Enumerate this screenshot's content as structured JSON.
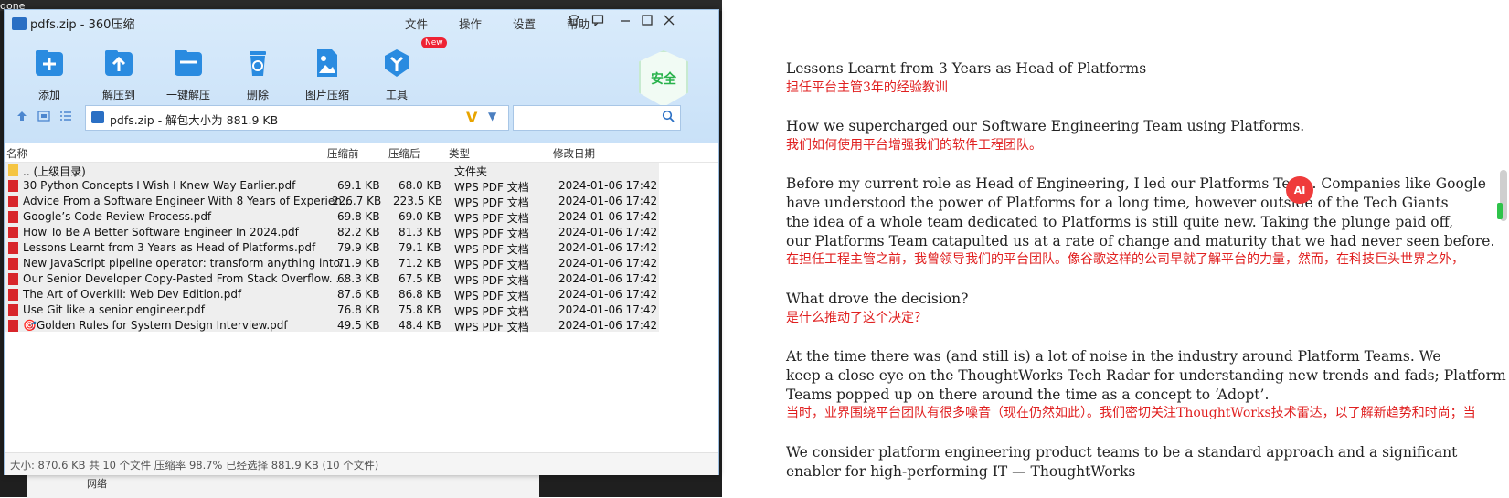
{
  "background": {
    "top_left_text": "done",
    "explorer_item": "网络"
  },
  "window": {
    "title": "pdfs.zip - 360压缩",
    "menus": [
      "文件",
      "操作",
      "设置",
      "帮助"
    ],
    "toolbar": [
      {
        "label": "添加",
        "icon": "add-icon"
      },
      {
        "label": "解压到",
        "icon": "extract-to-icon"
      },
      {
        "label": "一键解压",
        "icon": "one-click-extract-icon"
      },
      {
        "label": "删除",
        "icon": "delete-icon"
      },
      {
        "label": "图片压缩",
        "icon": "image-compress-icon"
      },
      {
        "label": "工具",
        "icon": "tools-icon"
      }
    ],
    "new_tag": "New",
    "safety_badge": "安全",
    "address": "pdfs.zip - 解包大小为 881.9 KB",
    "columns": [
      "名称",
      "压缩前",
      "压缩后",
      "类型",
      "修改日期"
    ],
    "parent_row": {
      "name": ".. (上级目录)",
      "type": "文件夹"
    },
    "files": [
      {
        "name": "30 Python Concepts I Wish I Knew Way Earlier.pdf",
        "before": "69.1 KB",
        "after": "68.0 KB",
        "type": "WPS PDF 文档",
        "date": "2024-01-06 17:42"
      },
      {
        "name": "Advice From a Software Engineer With 8 Years of Experien...",
        "before": "226.7 KB",
        "after": "223.5 KB",
        "type": "WPS PDF 文档",
        "date": "2024-01-06 17:42"
      },
      {
        "name": "Google’s Code Review Process.pdf",
        "before": "69.8 KB",
        "after": "69.0 KB",
        "type": "WPS PDF 文档",
        "date": "2024-01-06 17:42"
      },
      {
        "name": "How To Be A Better Software Engineer In 2024.pdf",
        "before": "82.2 KB",
        "after": "81.3 KB",
        "type": "WPS PDF 文档",
        "date": "2024-01-06 17:42"
      },
      {
        "name": "Lessons Learnt from 3 Years as Head of Platforms.pdf",
        "before": "79.9 KB",
        "after": "79.1 KB",
        "type": "WPS PDF 文档",
        "date": "2024-01-06 17:42"
      },
      {
        "name": "New JavaScript pipeline operator: transform anything into...",
        "before": "71.9 KB",
        "after": "71.2 KB",
        "type": "WPS PDF 文档",
        "date": "2024-01-06 17:42"
      },
      {
        "name": "Our Senior Developer Copy-Pasted From Stack Overflow. ...",
        "before": "68.3 KB",
        "after": "67.5 KB",
        "type": "WPS PDF 文档",
        "date": "2024-01-06 17:42"
      },
      {
        "name": "The Art of Overkill: Web Dev Edition.pdf",
        "before": "87.6 KB",
        "after": "86.8 KB",
        "type": "WPS PDF 文档",
        "date": "2024-01-06 17:42"
      },
      {
        "name": "Use Git like a senior engineer.pdf",
        "before": "76.8 KB",
        "after": "75.8 KB",
        "type": "WPS PDF 文档",
        "date": "2024-01-06 17:42"
      },
      {
        "name": "🎯Golden Rules for System Design Interview.pdf",
        "before": "49.5 KB",
        "after": "48.4 KB",
        "type": "WPS PDF 文档",
        "date": "2024-01-06 17:42"
      }
    ],
    "status": "大小: 870.6 KB 共 10 个文件 压缩率 98.7% 已经选择 881.9 KB (10 个文件)"
  },
  "document": {
    "ai_badge": "AI",
    "lines": [
      {
        "text": "Lessons Learnt from 3 Years as Head of Platforms",
        "lang": "en"
      },
      {
        "text": "担任平台主管3年的经验教训",
        "lang": "zh"
      },
      {
        "text": "How we supercharged our Software Engineering Team using Platforms.",
        "lang": "en"
      },
      {
        "text": "我们如何使用平台增强我们的软件工程团队。",
        "lang": "zh"
      },
      {
        "text": "Before my current role as Head of Engineering, I led our Platforms Team. Companies like Google",
        "lang": "en"
      },
      {
        "text": "have understood the power of Platforms for a long time, however outside of the Tech Giants",
        "lang": "en"
      },
      {
        "text": "the idea of a whole team dedicated to Platforms is still quite new. Taking the plunge paid off,",
        "lang": "en"
      },
      {
        "text": "our Platforms Team catapulted us at a rate of change and maturity that we had never seen before.",
        "lang": "en"
      },
      {
        "text": "在担任工程主管之前，我曾领导我们的平台团队。像谷歌这样的公司早就了解平台的力量，然而，在科技巨头世界之外，",
        "lang": "zh"
      },
      {
        "text": "What drove the decision?",
        "lang": "en"
      },
      {
        "text": "是什么推动了这个决定？",
        "lang": "zh"
      },
      {
        "text": "At the time there was (and still is) a lot of noise in the industry around Platform Teams. We",
        "lang": "en"
      },
      {
        "text": "keep a close eye on the ThoughtWorks Tech Radar for understanding new trends and fads; Platform",
        "lang": "en"
      },
      {
        "text": "Teams popped up on there around the time as a concept to ‘Adopt’.",
        "lang": "en"
      },
      {
        "text": "当时，业界围绕平台团队有很多噪音（现在仍然如此）。我们密切关注ThoughtWorks技术雷达，以了解新趋势和时尚；当",
        "lang": "zh"
      },
      {
        "text": "We consider platform engineering product teams to be a standard approach and a significant",
        "lang": "en"
      },
      {
        "text": "enabler for high-performing IT — ThoughtWorks",
        "lang": "en"
      }
    ]
  }
}
